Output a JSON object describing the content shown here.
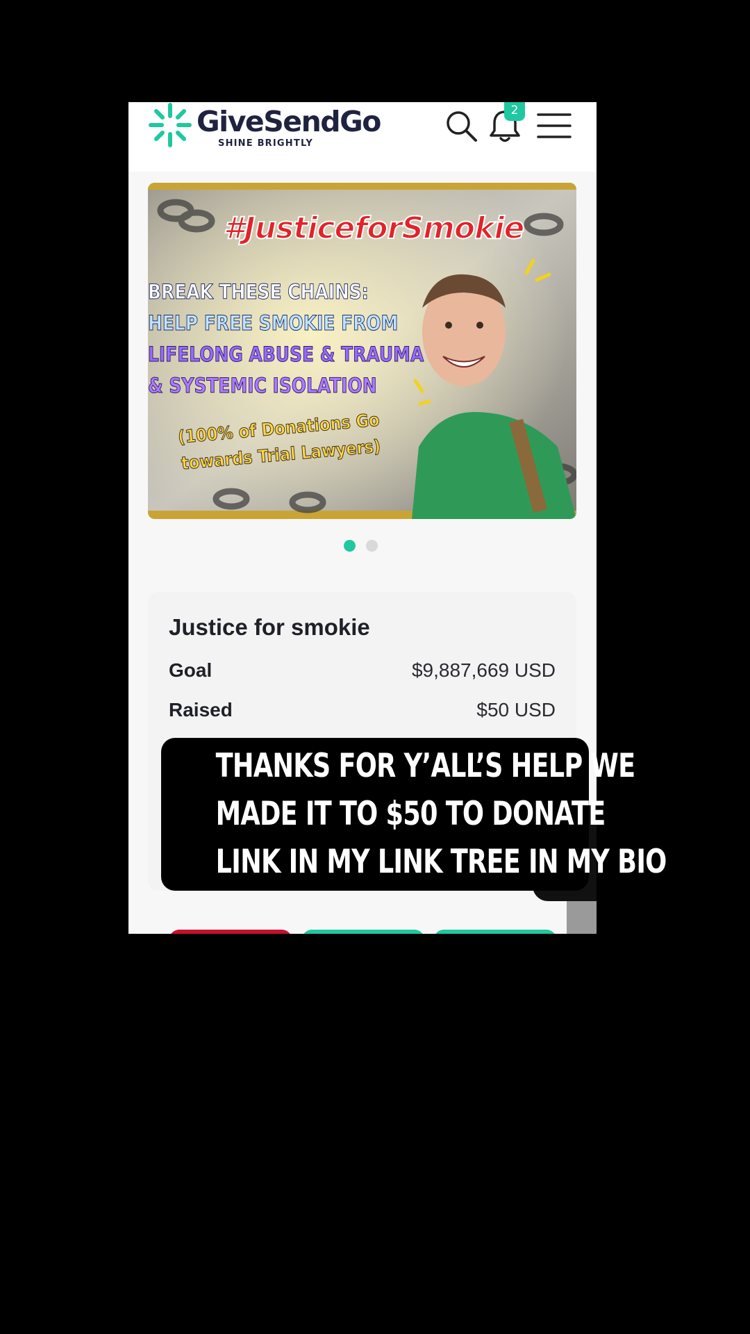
{
  "app": {
    "brand_name": "GiveSendGo",
    "brand_tagline": "SHINE BRIGHTLY",
    "accent_color": "#1fc8a0",
    "notification_count": "2",
    "icons": [
      "sunburst-logo-icon",
      "search-icon",
      "bell-icon",
      "hamburger-menu-icon"
    ]
  },
  "hero": {
    "hashtag": "#JusticeforSmokie",
    "headline": [
      "BREAK THESE CHAINS:",
      "HELP FREE SMOKIE FROM",
      "LIFELONG ABUSE & TRAUMA",
      "& SYSTEMIC ISOLATION"
    ],
    "subline": [
      "(100% of Donations Go",
      "towards Trial Lawyers)"
    ],
    "slide_count": 2,
    "active_slide": 1
  },
  "campaign": {
    "title": "Justice for smokie",
    "goal_label": "Goal",
    "goal_value": "$9,887,669 USD",
    "raised_label": "Raised",
    "raised_value": "$50 USD"
  },
  "caption": {
    "lines": [
      "Thanks for y’all’s help we",
      "made it to $50 to donate",
      "link in my link tree in my bio"
    ]
  }
}
